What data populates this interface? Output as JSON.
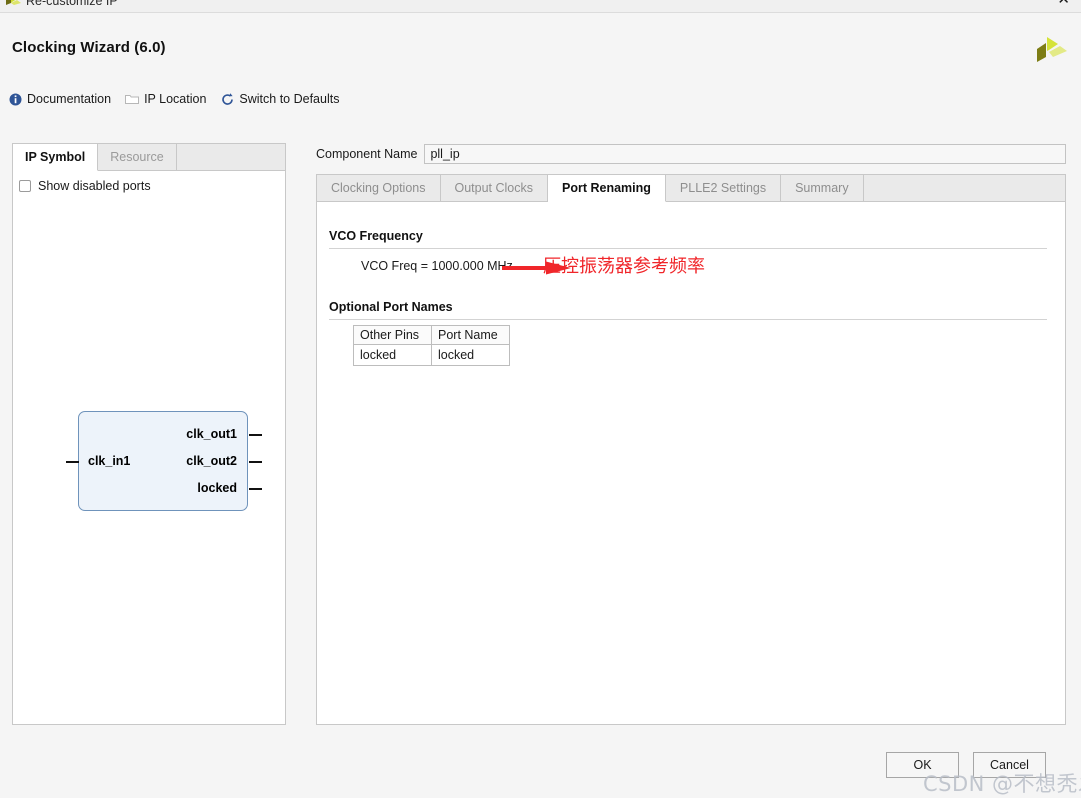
{
  "window": {
    "title": "Re-customize IP",
    "close_label": "✕",
    "app_icon": "xilinx-arrow-icon"
  },
  "header": {
    "dialog_title": "Clocking Wizard (6.0)",
    "logo": "xilinx-logo"
  },
  "toolbar": {
    "links": [
      {
        "label": "Documentation",
        "icon": "info-icon"
      },
      {
        "label": "IP Location",
        "icon": "folder-icon"
      },
      {
        "label": "Switch to Defaults",
        "icon": "refresh-icon"
      }
    ]
  },
  "left_panel": {
    "tabs": [
      {
        "label": "IP Symbol",
        "active": true
      },
      {
        "label": "Resource",
        "active": false
      }
    ],
    "show_disabled_ports": {
      "label": "Show disabled ports",
      "checked": false
    },
    "symbol": {
      "inputs": [
        "clk_in1"
      ],
      "outputs": [
        "clk_out1",
        "clk_out2",
        "locked"
      ]
    }
  },
  "component": {
    "label": "Component Name",
    "value": "pll_ip",
    "placeholder": ""
  },
  "right_panel": {
    "tabs": [
      {
        "label": "Clocking Options",
        "active": false
      },
      {
        "label": "Output Clocks",
        "active": false
      },
      {
        "label": "Port Renaming",
        "active": true
      },
      {
        "label": "PLLE2 Settings",
        "active": false
      },
      {
        "label": "Summary",
        "active": false
      }
    ],
    "vco_section": {
      "title": "VCO Frequency",
      "value_text": "VCO Freq = 1000.000 MHz"
    },
    "annotation": {
      "text": "压控振荡器参考频率",
      "color": "#f0262a"
    },
    "optional_ports": {
      "title": "Optional Port Names",
      "columns": [
        "Other Pins",
        "Port Name"
      ],
      "rows": [
        {
          "other_pin": "locked",
          "port_name": "locked"
        }
      ]
    }
  },
  "footer": {
    "ok_label": "OK",
    "cancel_label": "Cancel"
  },
  "watermark": {
    "text": "CSDN @不想秃发"
  }
}
